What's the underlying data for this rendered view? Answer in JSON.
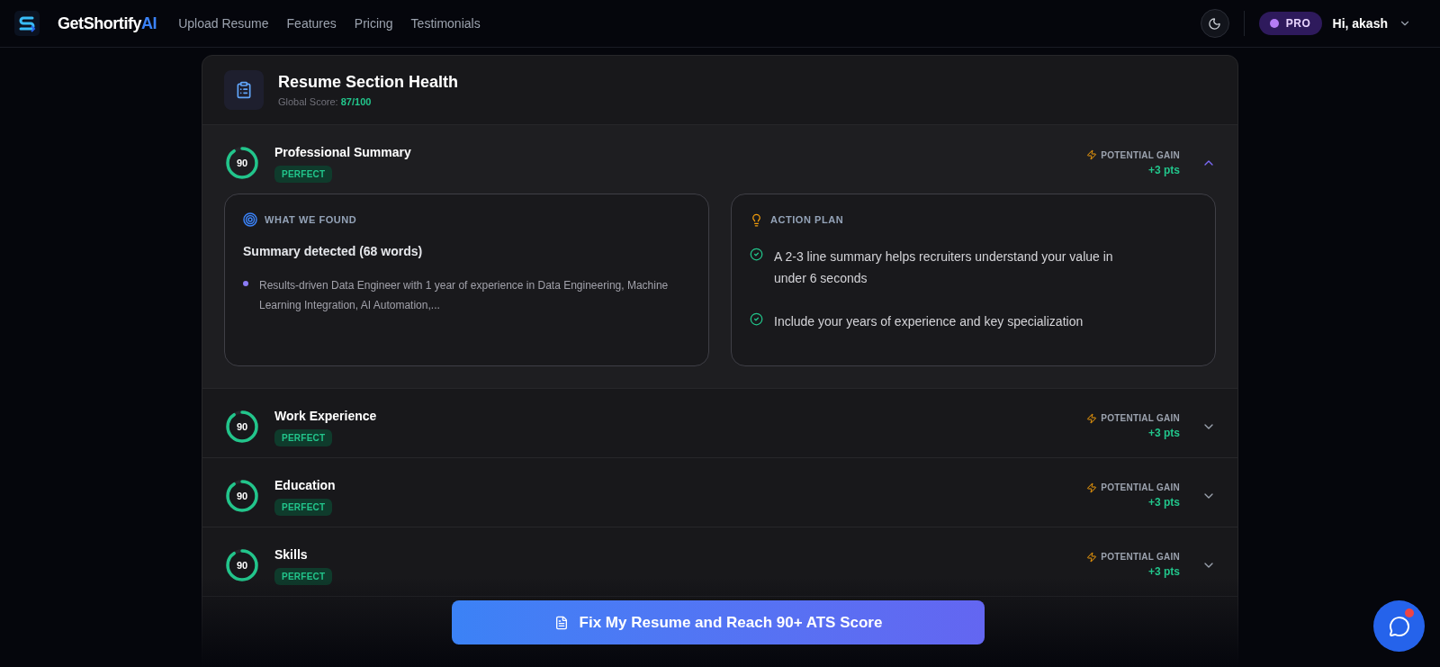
{
  "nav": {
    "brand": "GetShortify",
    "brand_accent": "AI",
    "links": [
      "Upload Resume",
      "Features",
      "Pricing",
      "Testimonials"
    ],
    "plan_badge": "PRO",
    "greeting": "Hi, akash"
  },
  "panel": {
    "title": "Resume Section Health",
    "score_label": "Global Score:",
    "score_value": "87/100"
  },
  "sections": [
    {
      "name": "Professional Summary",
      "score": "90",
      "status": "PERFECT",
      "gain_label": "POTENTIAL GAIN",
      "gain_value": "+3 pts",
      "expanded": true,
      "found": {
        "heading": "WHAT WE FOUND",
        "summary": "Summary detected (68 words)",
        "items": [
          "Results-driven Data Engineer with 1 year of experience in Data Engineering, Machine Learning Integration, AI Automation,..."
        ]
      },
      "plan": {
        "heading": "ACTION PLAN",
        "items": [
          "A 2-3 line summary helps recruiters understand your value in under 6 seconds",
          "Include your years of experience and key specialization"
        ]
      }
    },
    {
      "name": "Work Experience",
      "score": "90",
      "status": "PERFECT",
      "gain_label": "POTENTIAL GAIN",
      "gain_value": "+3 pts",
      "expanded": false
    },
    {
      "name": "Education",
      "score": "90",
      "status": "PERFECT",
      "gain_label": "POTENTIAL GAIN",
      "gain_value": "+3 pts",
      "expanded": false
    },
    {
      "name": "Skills",
      "score": "90",
      "status": "PERFECT",
      "gain_label": "POTENTIAL GAIN",
      "gain_value": "+3 pts",
      "expanded": false
    }
  ],
  "cta": {
    "label": "Fix My Resume and Reach 90+ ATS Score"
  },
  "chat": {
    "unread": true
  }
}
